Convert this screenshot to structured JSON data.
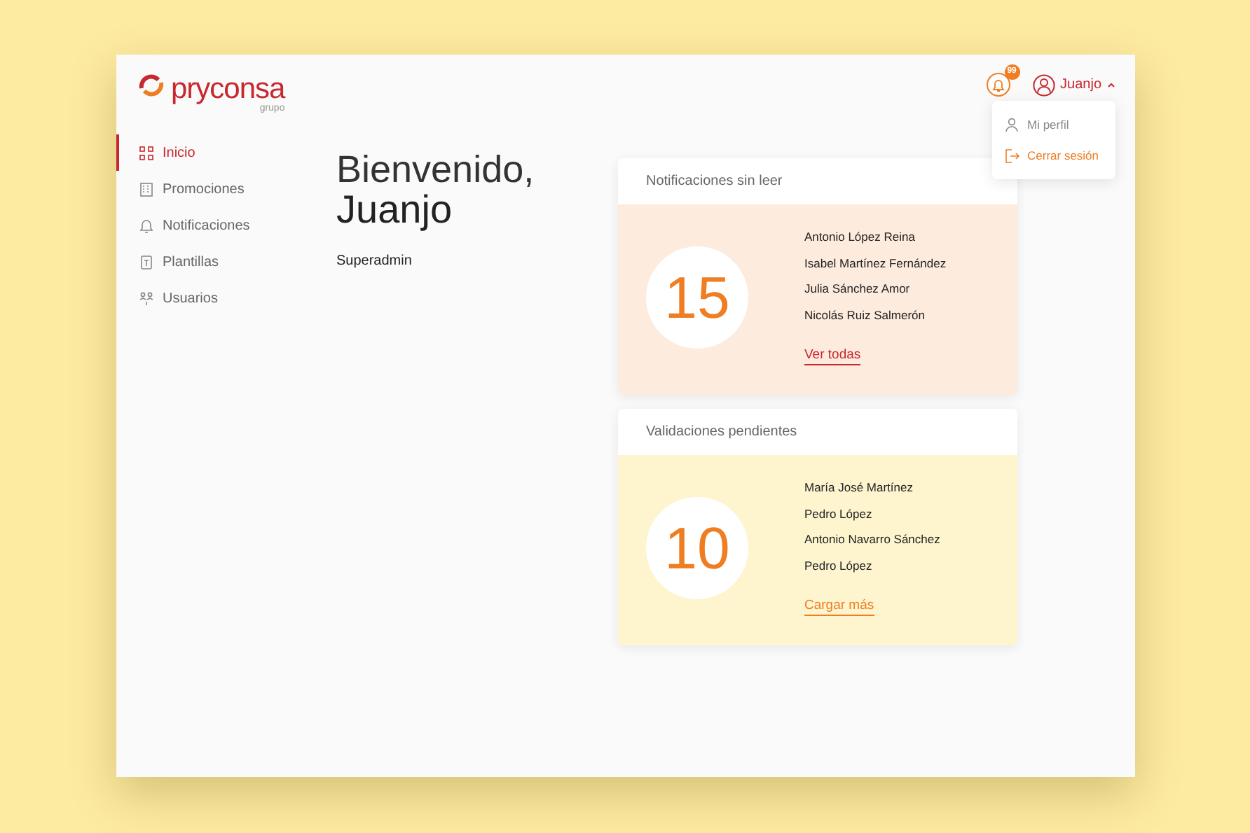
{
  "brand": {
    "name": "pryconsa",
    "tagline": "grupo"
  },
  "header": {
    "notification_badge": "99",
    "user": "Juanjo",
    "menu_expanded": true
  },
  "user_menu": [
    {
      "kind": "profile",
      "label": "Mi perfil"
    },
    {
      "kind": "logout",
      "label": "Cerrar sesión"
    }
  ],
  "sidebar": {
    "items": [
      {
        "kind": "home",
        "label": "Inicio",
        "selected": true
      },
      {
        "kind": "building",
        "label": "Promociones",
        "selected": false
      },
      {
        "kind": "bell",
        "label": "Notificaciones",
        "selected": false
      },
      {
        "kind": "template",
        "label": "Plantillas",
        "selected": false
      },
      {
        "kind": "users",
        "label": "Usuarios",
        "selected": false
      }
    ]
  },
  "greeting": {
    "line1": "Bienvenido,",
    "line2": "Juanjo",
    "role": "Superadmin"
  },
  "cards": [
    {
      "title": "Notificaciones sin leer",
      "kind": "notifications",
      "count": "15",
      "names": [
        "Antonio López Reina",
        "Isabel Martínez Fernández",
        "Julia Sánchez Amor",
        "Nicolás Ruiz Salmerón"
      ],
      "link": "Ver todas"
    },
    {
      "title": "Validaciones pendientes",
      "kind": "validations",
      "count": "10",
      "names": [
        "María José Martínez",
        "Pedro López",
        "Antonio Navarro Sánchez",
        "Pedro López"
      ],
      "link": "Cargar más"
    }
  ]
}
